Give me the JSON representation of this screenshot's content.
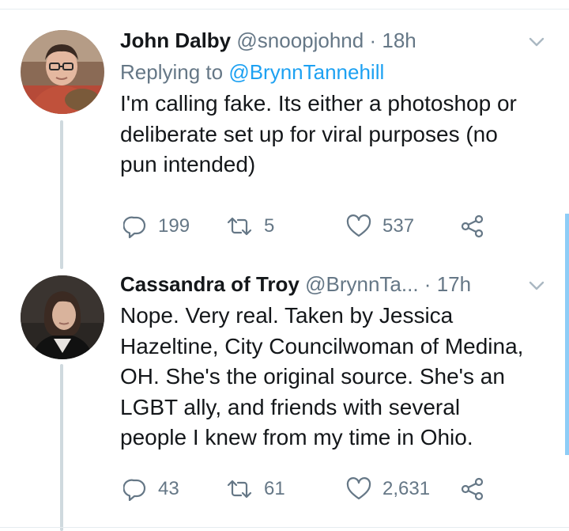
{
  "tweets": [
    {
      "name": "John Dalby",
      "handle": "@snoopjohnd",
      "separator": "·",
      "time": "18h",
      "replying_prefix": "Replying to ",
      "replying_to": "@BrynnTannehill",
      "text": "I'm calling fake. Its either a photoshop or\ndeliberate set up for viral purposes (no\npun intended)",
      "replies": "199",
      "retweets": "5",
      "likes": "537",
      "avatar_icon": "profile-photo-man-glasses"
    },
    {
      "name": "Cassandra of Troy",
      "handle": "@BrynnTa...",
      "separator": "·",
      "time": "17h",
      "text": "Nope. Very real. Taken by Jessica\nHazeltine, City Councilwoman of Medina,\nOH. She's the original source. She's an\nLGBT ally, and friends with several\npeople I knew from my time in Ohio.",
      "replies": "43",
      "retweets": "61",
      "likes": "2,631",
      "avatar_icon": "profile-photo-woman"
    }
  ],
  "icons": {
    "reply": "reply-icon",
    "retweet": "retweet-icon",
    "like": "heart-icon",
    "share": "share-icon",
    "menu": "chevron-down-icon"
  },
  "colors": {
    "link": "#1da1f2",
    "muted": "#657786",
    "text": "#14171a",
    "thread_line": "#cfd9de",
    "scroll_indicator": "#8ecdf7"
  }
}
